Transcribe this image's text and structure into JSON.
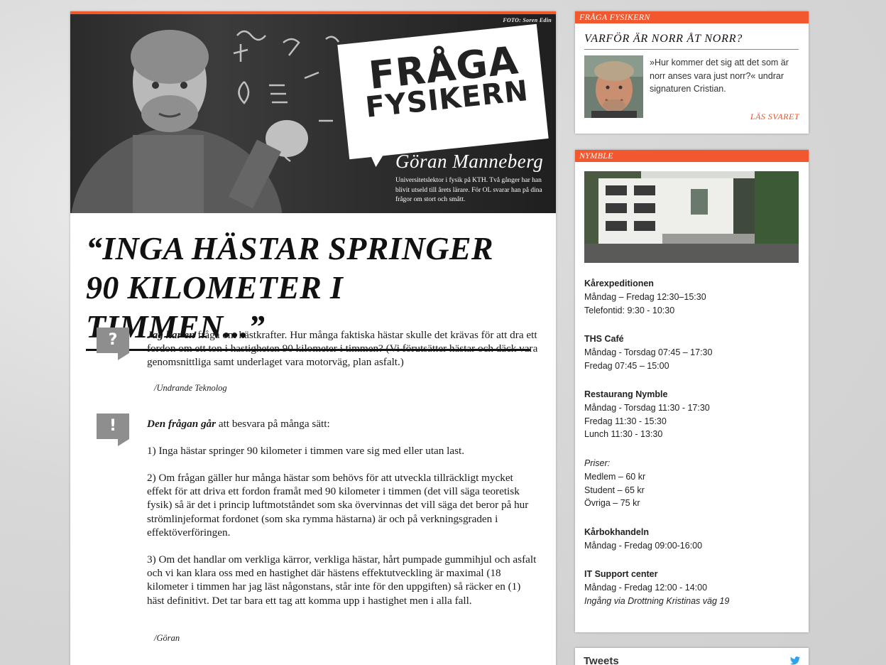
{
  "hero": {
    "photo_credit": "FOTO: Soren Edin",
    "bubble_line1": "FRÅGA",
    "bubble_line2": "FYSIKERN",
    "name": "Göran Manneberg",
    "bio": "Universitetslektor i fysik på KTH. Två gånger har han blivit utseld till årets lärare. För OL svarar han på dina frågor om stort och smått."
  },
  "article": {
    "headline": "“INGA HÄSTAR SPRINGER 90 KILOMETER I TIMMEN...”",
    "question_icon": "?",
    "answer_icon": "!",
    "question_lead": "Jag har en",
    "question_text": " fråga om hästkrafter. Hur många faktiska hästar skulle det krävas för att dra ett fordon om ett ton i hastigheten 90 kilometer i timmen? (Vi förutsätter hästar och däck vara genomsnittliga samt underlaget vara motorväg, plan asfalt.)",
    "question_sig": "/Undrande Teknolog",
    "answer_lead": "Den frågan går",
    "answer_intro": " att besvara på många sätt:",
    "answer_p1": "1) Inga hästar springer 90 kilometer i timmen vare sig med eller utan last.",
    "answer_p2": "2) Om frågan gäller hur många hästar som behövs för att utveckla tillräckligt mycket effekt för att driva ett fordon framåt med 90 kilometer i timmen (det vill säga teoretisk fysik) så är det i princip luftmotståndet som ska övervinnas det vill säga det beror på hur strömlinjeformat fordonet (som ska rymma hästarna) är och på verkningsgraden i effektöverföringen.",
    "answer_p3": "3) Om det handlar om verkliga kärror, verkliga hästar, hårt pumpade gummihjul och asfalt och vi kan klara oss med en hastighet där hästens effektutveckling är maximal (18 kilometer i timmen har jag läst någonstans, står inte för den uppgiften) så räcker en (1) häst definitivt. Det tar bara ett tag att komma upp i hastighet men i alla fall.",
    "answer_sig": "/Göran"
  },
  "sidebar": {
    "fraga": {
      "header": "FRÅGA FYSIKERN",
      "title": "VARFÖR ÄR NORR ÅT NORR?",
      "text": "»Hur kommer det sig att det som är norr anses vara just norr?« undrar signaturen Cristian.",
      "link": "LÄS SVARET"
    },
    "nymble": {
      "header": "NYMBLE",
      "sections": [
        {
          "title": "Kårexpeditionen",
          "lines": [
            "Måndag – Fredag 12:30–15:30",
            "Telefontid: 9:30 - 10:30"
          ]
        },
        {
          "title": "THS Café",
          "lines": [
            "Måndag - Torsdag 07:45 – 17:30",
            "Fredag 07:45 – 15:00"
          ]
        },
        {
          "title": "Restaurang Nymble",
          "lines": [
            "Måndag - Torsdag 11:30 - 17:30",
            "Fredag 11:30 - 15:30",
            "Lunch 11:30 - 13:30"
          ]
        },
        {
          "title": "Priser:",
          "lines": [
            "Medlem – 60 kr",
            "Student – 65 kr",
            "Övriga – 75 kr"
          ]
        },
        {
          "title": "Kårbokhandeln",
          "lines": [
            "Måndag - Fredag 09:00-16:00"
          ]
        },
        {
          "title": "IT Support center",
          "lines": [
            "Måndag - Fredag 12:00 - 14:00",
            "Ingång via Drottning Kristinas väg 19"
          ]
        }
      ]
    },
    "tweets": {
      "title": "Tweets"
    }
  },
  "colors": {
    "accent": "#f2572d",
    "icon_gray": "#8e8e8e"
  }
}
